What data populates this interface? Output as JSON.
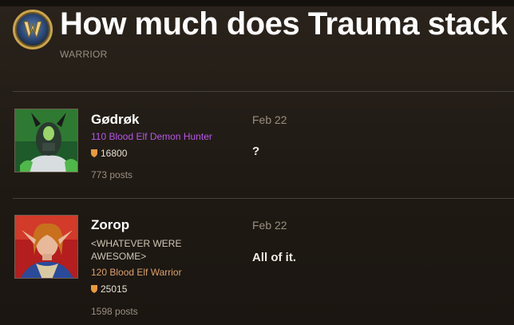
{
  "topic": {
    "title": "How much does Trauma stack",
    "category": "WARRIOR"
  },
  "posts": [
    {
      "username": "Gødrøk",
      "char_class": "110 Blood Elf Demon Hunter",
      "class_color": "#a330c9",
      "achievement_points": "16800",
      "post_count": "773 posts",
      "date": "Feb 22",
      "body": "?"
    },
    {
      "username": "Zorop",
      "title_text": "<WHATEVER WERE AWESOME>",
      "char_class": "120 Blood Elf Warrior",
      "class_color": "#c79c6e",
      "achievement_points": "25015",
      "post_count": "1598 posts",
      "date": "Feb 22",
      "body": "All of it."
    }
  ],
  "colors": {
    "accent_gold": "#e89a3c",
    "divider": "#4a4036"
  },
  "icons": {
    "logo": "wow-logo-icon",
    "achievement": "shield-icon"
  }
}
